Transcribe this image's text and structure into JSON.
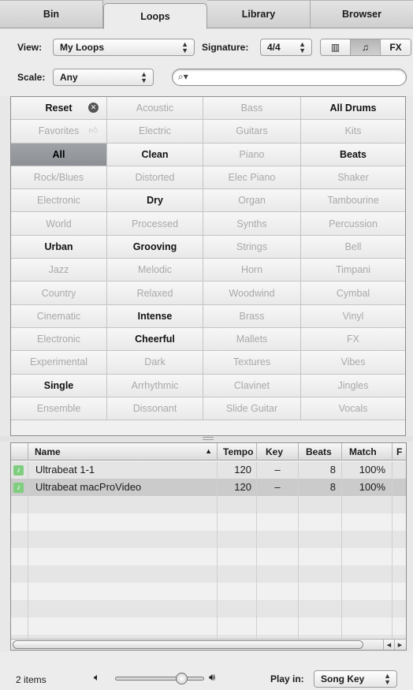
{
  "tabs": [
    {
      "label": "Bin",
      "active": false
    },
    {
      "label": "Loops",
      "active": true
    },
    {
      "label": "Library",
      "active": false
    },
    {
      "label": "Browser",
      "active": false
    }
  ],
  "view": {
    "label": "View:",
    "value": "My Loops"
  },
  "signature": {
    "label": "Signature:",
    "value": "4/4"
  },
  "view_mode_buttons": [
    {
      "icon": "column-view-icon",
      "glyph": "▥",
      "selected": false
    },
    {
      "icon": "music-note-icon",
      "glyph": "♫",
      "selected": true
    },
    {
      "icon": "fx-icon",
      "glyph": "FX",
      "selected": false
    }
  ],
  "scale": {
    "label": "Scale:",
    "value": "Any"
  },
  "search": {
    "value": "",
    "icon": "search-icon"
  },
  "keywords": [
    [
      {
        "t": "Reset",
        "s": "strong",
        "badge": "x"
      },
      {
        "t": "Acoustic",
        "s": "dim"
      },
      {
        "t": "Bass",
        "s": "dim"
      },
      {
        "t": "All Drums",
        "s": "strong"
      }
    ],
    [
      {
        "t": "Favorites",
        "s": "dim",
        "thumb": true
      },
      {
        "t": "Electric",
        "s": "dim"
      },
      {
        "t": "Guitars",
        "s": "dim"
      },
      {
        "t": "Kits",
        "s": "dim"
      }
    ],
    [
      {
        "t": "All",
        "s": "sel"
      },
      {
        "t": "Clean",
        "s": "strong"
      },
      {
        "t": "Piano",
        "s": "dim"
      },
      {
        "t": "Beats",
        "s": "strong"
      }
    ],
    [
      {
        "t": "Rock/Blues",
        "s": "dim"
      },
      {
        "t": "Distorted",
        "s": "dim"
      },
      {
        "t": "Elec Piano",
        "s": "dim"
      },
      {
        "t": "Shaker",
        "s": "dim"
      }
    ],
    [
      {
        "t": "Electronic",
        "s": "dim"
      },
      {
        "t": "Dry",
        "s": "strong"
      },
      {
        "t": "Organ",
        "s": "dim"
      },
      {
        "t": "Tambourine",
        "s": "dim"
      }
    ],
    [
      {
        "t": "World",
        "s": "dim"
      },
      {
        "t": "Processed",
        "s": "dim"
      },
      {
        "t": "Synths",
        "s": "dim"
      },
      {
        "t": "Percussion",
        "s": "dim"
      }
    ],
    [
      {
        "t": "Urban",
        "s": "strong"
      },
      {
        "t": "Grooving",
        "s": "strong"
      },
      {
        "t": "Strings",
        "s": "dim"
      },
      {
        "t": "Bell",
        "s": "dim"
      }
    ],
    [
      {
        "t": "Jazz",
        "s": "dim"
      },
      {
        "t": "Melodic",
        "s": "dim"
      },
      {
        "t": "Horn",
        "s": "dim"
      },
      {
        "t": "Timpani",
        "s": "dim"
      }
    ],
    [
      {
        "t": "Country",
        "s": "dim"
      },
      {
        "t": "Relaxed",
        "s": "dim"
      },
      {
        "t": "Woodwind",
        "s": "dim"
      },
      {
        "t": "Cymbal",
        "s": "dim"
      }
    ],
    [
      {
        "t": "Cinematic",
        "s": "dim"
      },
      {
        "t": "Intense",
        "s": "strong"
      },
      {
        "t": "Brass",
        "s": "dim"
      },
      {
        "t": "Vinyl",
        "s": "dim"
      }
    ],
    [
      {
        "t": "Electronic",
        "s": "dim"
      },
      {
        "t": "Cheerful",
        "s": "strong"
      },
      {
        "t": "Mallets",
        "s": "dim"
      },
      {
        "t": "FX",
        "s": "dim"
      }
    ],
    [
      {
        "t": "Experimental",
        "s": "dim"
      },
      {
        "t": "Dark",
        "s": "dim"
      },
      {
        "t": "Textures",
        "s": "dim"
      },
      {
        "t": "Vibes",
        "s": "dim"
      }
    ],
    [
      {
        "t": "Single",
        "s": "strong"
      },
      {
        "t": "Arrhythmic",
        "s": "dim"
      },
      {
        "t": "Clavinet",
        "s": "dim"
      },
      {
        "t": "Jingles",
        "s": "dim"
      }
    ],
    [
      {
        "t": "Ensemble",
        "s": "dim"
      },
      {
        "t": "Dissonant",
        "s": "dim"
      },
      {
        "t": "Slide Guitar",
        "s": "dim"
      },
      {
        "t": "Vocals",
        "s": "dim"
      }
    ]
  ],
  "table": {
    "columns": {
      "name": "Name",
      "sort_arrow": "▲",
      "tempo": "Tempo",
      "key": "Key",
      "beats": "Beats",
      "match": "Match",
      "fav": "F"
    },
    "rows": [
      {
        "name": "Ultrabeat 1-1",
        "tempo": "120",
        "key": "–",
        "beats": "8",
        "match": "100%"
      },
      {
        "name": "Ultrabeat macProVideo",
        "tempo": "120",
        "key": "–",
        "beats": "8",
        "match": "100%"
      }
    ]
  },
  "footer": {
    "count": "2 items",
    "volume_fraction": 0.75,
    "play_in_label": "Play in:",
    "play_in_value": "Song Key"
  }
}
